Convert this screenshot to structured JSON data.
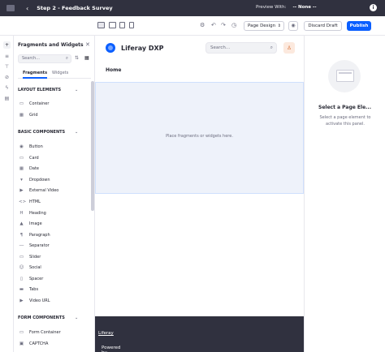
{
  "topbar": {
    "back_icon": "chevron-left-icon",
    "page_title": "Step 2 - Feedback Survey",
    "preview_label": "Preview With:",
    "preview_value": "-- None --",
    "info_icon": "i"
  },
  "toolbar": {
    "page_design_label": "Page Design",
    "discard_label": "Discard Draft",
    "publish_label": "Publish"
  },
  "panel": {
    "title": "Fragments and Widgets",
    "search_placeholder": "Search...",
    "tabs": [
      {
        "label": "Fragments",
        "active": true
      },
      {
        "label": "Widgets",
        "active": false
      }
    ],
    "sections": [
      {
        "title": "LAYOUT ELEMENTS",
        "items": [
          "Container",
          "Grid"
        ]
      },
      {
        "title": "BASIC COMPONENTS",
        "items": [
          "Button",
          "Card",
          "Date",
          "Dropdown",
          "External Video",
          "HTML",
          "Heading",
          "Image",
          "Paragraph",
          "Separator",
          "Slider",
          "Social",
          "Spacer",
          "Tabs",
          "Video URL"
        ]
      },
      {
        "title": "FORM COMPONENTS",
        "items": [
          "Form Container",
          "CAPTCHA"
        ]
      }
    ]
  },
  "canvas": {
    "brand": "Liferay DXP",
    "search_placeholder": "Search...",
    "nav_home": "Home",
    "dropzone_text": "Place fragments or widgets here.",
    "footer_prefix": "Powered by ",
    "footer_link": "Liferay"
  },
  "right_panel": {
    "title": "Select a Page Ele...",
    "description": "Select a page element to activate this panel."
  },
  "colors": {
    "topbar": "#30313f",
    "primary": "#0b5fff",
    "dropzone": "#eef2fa",
    "footer": "#30313f"
  }
}
